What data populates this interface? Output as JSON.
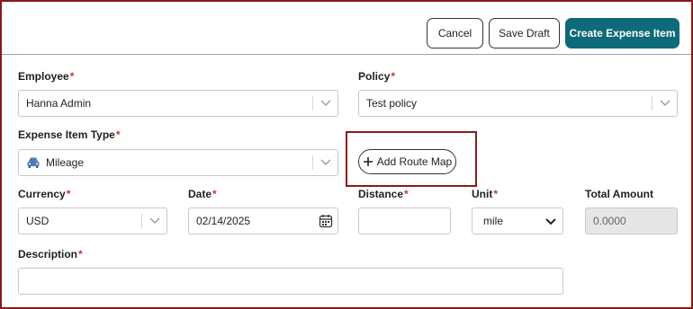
{
  "toolbar": {
    "cancel_label": "Cancel",
    "save_draft_label": "Save Draft",
    "create_label": "Create Expense Item"
  },
  "employee": {
    "label": "Employee",
    "value": "Hanna Admin"
  },
  "policy": {
    "label": "Policy",
    "value": "Test policy"
  },
  "expense_type": {
    "label": "Expense Item Type",
    "value": "Mileage",
    "icon": "car-icon"
  },
  "route_map": {
    "label": "Add Route Map",
    "icon": "plus-icon"
  },
  "currency": {
    "label": "Currency",
    "value": "USD"
  },
  "date": {
    "label": "Date",
    "value": "02/14/2025",
    "icon": "calendar-icon"
  },
  "distance": {
    "label": "Distance",
    "value": ""
  },
  "unit": {
    "label": "Unit",
    "value": "mile"
  },
  "total_amount": {
    "label": "Total Amount",
    "value": "0.0000"
  },
  "description": {
    "label": "Description",
    "value": ""
  },
  "required_marker": "*",
  "colors": {
    "primary": "#0e6a7a",
    "required": "#c0392b",
    "highlight": "#8b1a1a"
  }
}
